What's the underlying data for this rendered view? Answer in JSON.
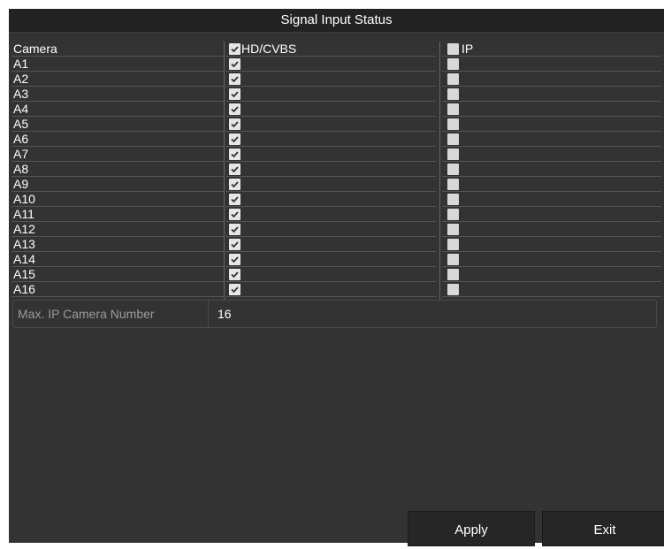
{
  "dialog": {
    "title": "Signal Input Status",
    "columns": [
      "Camera",
      "HD/CVBS",
      "IP"
    ],
    "header_checks": {
      "hd_cvbs": true,
      "ip": false
    },
    "rows": [
      {
        "camera": "A1",
        "hd_cvbs": true,
        "ip": false
      },
      {
        "camera": "A2",
        "hd_cvbs": true,
        "ip": false
      },
      {
        "camera": "A3",
        "hd_cvbs": true,
        "ip": false
      },
      {
        "camera": "A4",
        "hd_cvbs": true,
        "ip": false
      },
      {
        "camera": "A5",
        "hd_cvbs": true,
        "ip": false
      },
      {
        "camera": "A6",
        "hd_cvbs": true,
        "ip": false
      },
      {
        "camera": "A7",
        "hd_cvbs": true,
        "ip": false
      },
      {
        "camera": "A8",
        "hd_cvbs": true,
        "ip": false
      },
      {
        "camera": "A9",
        "hd_cvbs": true,
        "ip": false
      },
      {
        "camera": "A10",
        "hd_cvbs": true,
        "ip": false
      },
      {
        "camera": "A11",
        "hd_cvbs": true,
        "ip": false
      },
      {
        "camera": "A12",
        "hd_cvbs": true,
        "ip": false
      },
      {
        "camera": "A13",
        "hd_cvbs": true,
        "ip": false
      },
      {
        "camera": "A14",
        "hd_cvbs": true,
        "ip": false
      },
      {
        "camera": "A15",
        "hd_cvbs": true,
        "ip": false
      },
      {
        "camera": "A16",
        "hd_cvbs": true,
        "ip": false
      }
    ],
    "max_ip": {
      "label": "Max. IP Camera Number",
      "value": "16"
    },
    "buttons": {
      "apply": "Apply",
      "exit": "Exit"
    }
  },
  "colors": {
    "background": "#333333",
    "title_bar": "#222222",
    "text": "#ffffff",
    "muted_text": "#9a9a9a"
  },
  "icons": {
    "checked": "checkbox-checked-icon",
    "unchecked": "checkbox-unchecked-icon"
  }
}
